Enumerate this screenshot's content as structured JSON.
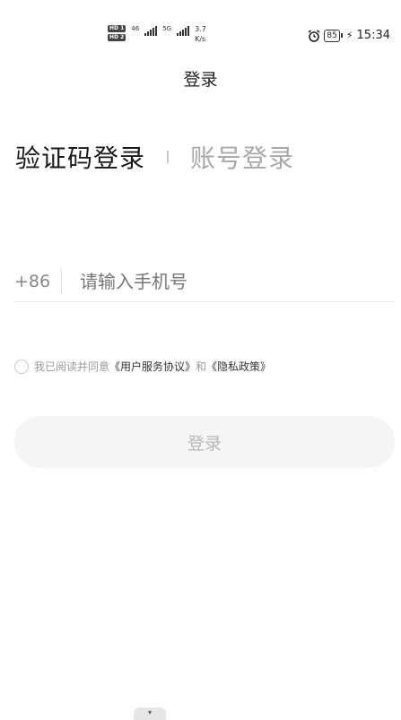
{
  "status_bar": {
    "hd1": "HD 1",
    "hd2": "HD 2",
    "net1": "46",
    "net2": "5G",
    "speed_value": "3.7",
    "speed_unit": "K/s",
    "battery": "85",
    "time": "15:34",
    "icons": [
      "alarm-icon",
      "charging-bolt-icon",
      "signal-icon"
    ]
  },
  "page": {
    "title": "登录"
  },
  "tabs": [
    {
      "label": "验证码登录",
      "active": true
    },
    {
      "label": "账号登录",
      "active": false
    }
  ],
  "phone": {
    "country_code": "+86",
    "placeholder": "请输入手机号",
    "value": ""
  },
  "agreement": {
    "prefix": "我已阅读并同意",
    "terms_link": "《用户服务协议》",
    "conjunction": "和",
    "privacy_link": "《隐私政策》",
    "checked": false
  },
  "login_button": {
    "label": "登录",
    "enabled": false
  },
  "colors": {
    "active_tab": "#1a1a1a",
    "inactive_tab": "#a8a8a8",
    "button_bg": "#f5f5f5",
    "button_text": "#b8b8b8"
  }
}
